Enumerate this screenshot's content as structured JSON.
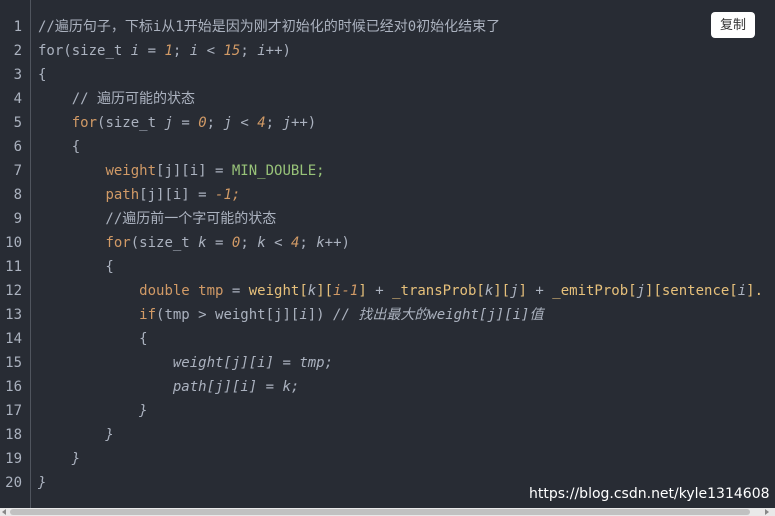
{
  "copy_button": {
    "label": "复制"
  },
  "watermark": "https://blog.csdn.net/kyle1314608",
  "line_numbers": [
    "1",
    "2",
    "3",
    "4",
    "5",
    "6",
    "7",
    "8",
    "9",
    "10",
    "11",
    "12",
    "13",
    "14",
    "15",
    "16",
    "17",
    "18",
    "19",
    "20"
  ],
  "code_lines": [
    [
      {
        "t": "//遍历句子，下标i从1开始是因为刚才初始化的时候已经对0初始化结束了",
        "c": "cm"
      }
    ],
    [
      {
        "t": "for",
        "c": "pl"
      },
      {
        "t": "(size_t ",
        "c": "pl"
      },
      {
        "t": "i",
        "c": "it"
      },
      {
        "t": " = ",
        "c": "pl"
      },
      {
        "t": "1",
        "c": "num"
      },
      {
        "t": "; ",
        "c": "pl"
      },
      {
        "t": "i",
        "c": "it"
      },
      {
        "t": " < ",
        "c": "pl"
      },
      {
        "t": "15",
        "c": "num"
      },
      {
        "t": "; ",
        "c": "pl"
      },
      {
        "t": "i",
        "c": "it"
      },
      {
        "t": "++)",
        "c": "pl"
      }
    ],
    [
      {
        "t": "{",
        "c": "pl"
      }
    ],
    [
      {
        "t": "    // 遍历可能的状态",
        "c": "cm"
      }
    ],
    [
      {
        "t": "    ",
        "c": "pl"
      },
      {
        "t": "for",
        "c": "orange"
      },
      {
        "t": "(size_t ",
        "c": "pl"
      },
      {
        "t": "j",
        "c": "it"
      },
      {
        "t": " = ",
        "c": "pl"
      },
      {
        "t": "0",
        "c": "num"
      },
      {
        "t": "; ",
        "c": "pl"
      },
      {
        "t": "j",
        "c": "it"
      },
      {
        "t": " < ",
        "c": "pl"
      },
      {
        "t": "4",
        "c": "num"
      },
      {
        "t": "; ",
        "c": "pl"
      },
      {
        "t": "j",
        "c": "it"
      },
      {
        "t": "++)",
        "c": "pl"
      }
    ],
    [
      {
        "t": "    {",
        "c": "pl"
      }
    ],
    [
      {
        "t": "        ",
        "c": "pl"
      },
      {
        "t": "weight",
        "c": "orange"
      },
      {
        "t": "[j][i] = ",
        "c": "pl"
      },
      {
        "t": "MIN_DOUBLE;",
        "c": "green"
      }
    ],
    [
      {
        "t": "        ",
        "c": "pl"
      },
      {
        "t": "path",
        "c": "orange"
      },
      {
        "t": "[j][i] = ",
        "c": "pl"
      },
      {
        "t": "-1;",
        "c": "num"
      }
    ],
    [
      {
        "t": "        //遍历前一个字可能的状态",
        "c": "cm"
      }
    ],
    [
      {
        "t": "        ",
        "c": "pl"
      },
      {
        "t": "for",
        "c": "orange"
      },
      {
        "t": "(size_t ",
        "c": "pl"
      },
      {
        "t": "k",
        "c": "it"
      },
      {
        "t": " = ",
        "c": "pl"
      },
      {
        "t": "0",
        "c": "num"
      },
      {
        "t": "; ",
        "c": "pl"
      },
      {
        "t": "k",
        "c": "it"
      },
      {
        "t": " < ",
        "c": "pl"
      },
      {
        "t": "4",
        "c": "num"
      },
      {
        "t": "; ",
        "c": "pl"
      },
      {
        "t": "k",
        "c": "it"
      },
      {
        "t": "++)",
        "c": "pl"
      }
    ],
    [
      {
        "t": "        {",
        "c": "pl"
      }
    ],
    [
      {
        "t": "            ",
        "c": "pl"
      },
      {
        "t": "double tmp",
        "c": "orange"
      },
      {
        "t": " = ",
        "c": "pl"
      },
      {
        "t": "weight[",
        "c": "em"
      },
      {
        "t": "k",
        "c": "it"
      },
      {
        "t": "][",
        "c": "em"
      },
      {
        "t": "i-1",
        "c": "num"
      },
      {
        "t": "]",
        "c": "em"
      },
      {
        "t": " + ",
        "c": "pl"
      },
      {
        "t": "_transProb[",
        "c": "em"
      },
      {
        "t": "k",
        "c": "it"
      },
      {
        "t": "][",
        "c": "em"
      },
      {
        "t": "j",
        "c": "it"
      },
      {
        "t": "]",
        "c": "em"
      },
      {
        "t": " + ",
        "c": "pl"
      },
      {
        "t": "_emitProb[",
        "c": "em"
      },
      {
        "t": "j",
        "c": "it"
      },
      {
        "t": "][",
        "c": "em"
      },
      {
        "t": "sentence[",
        "c": "em"
      },
      {
        "t": "i",
        "c": "it"
      },
      {
        "t": "].",
        "c": "em"
      }
    ],
    [
      {
        "t": "            ",
        "c": "pl"
      },
      {
        "t": "if",
        "c": "orange"
      },
      {
        "t": "(tmp > weight[j][",
        "c": "pl"
      },
      {
        "t": "i",
        "c": "it"
      },
      {
        "t": "]) ",
        "c": "pl"
      },
      {
        "t": "// 找出最大的weight[j][i]值",
        "c": "it"
      }
    ],
    [
      {
        "t": "            {",
        "c": "pl"
      }
    ],
    [
      {
        "t": "                ",
        "c": "pl"
      },
      {
        "t": "weight[",
        "c": "it"
      },
      {
        "t": "j",
        "c": "it"
      },
      {
        "t": "][",
        "c": "it"
      },
      {
        "t": "i",
        "c": "it"
      },
      {
        "t": "] = tmp;",
        "c": "it"
      }
    ],
    [
      {
        "t": "                ",
        "c": "pl"
      },
      {
        "t": "path[",
        "c": "it"
      },
      {
        "t": "j",
        "c": "it"
      },
      {
        "t": "][",
        "c": "it"
      },
      {
        "t": "i",
        "c": "it"
      },
      {
        "t": "] = k;",
        "c": "it"
      }
    ],
    [
      {
        "t": "            }",
        "c": "it"
      }
    ],
    [
      {
        "t": "        }",
        "c": "it"
      }
    ],
    [
      {
        "t": "    }",
        "c": "it"
      }
    ],
    [
      {
        "t": "}",
        "c": "it"
      }
    ]
  ]
}
